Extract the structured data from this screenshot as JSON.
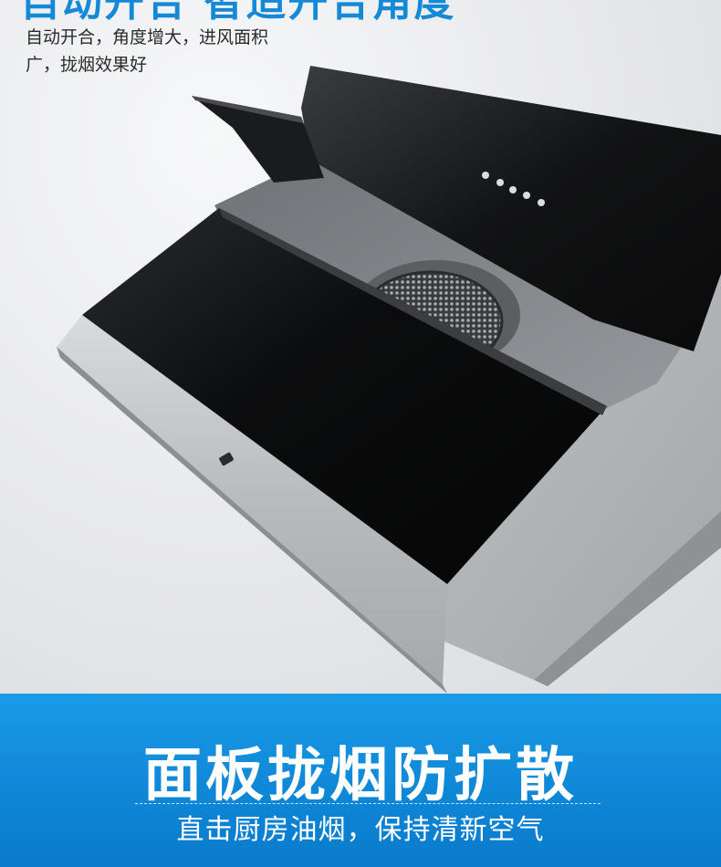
{
  "top": {
    "headline": "自动开合  智适开合角度",
    "description_lines": [
      "自动开合，角度增大，进风面积",
      "广，拢烟效果好"
    ]
  },
  "banner": {
    "title": "面板拢烟防扩散",
    "subtitle": "直击厨房油烟，保持清新空气"
  },
  "colors": {
    "accent": "#1489d8",
    "banner": "#0e86d6"
  },
  "icons": [
    "range-hood-product-image",
    "touch-control-button-icon"
  ]
}
